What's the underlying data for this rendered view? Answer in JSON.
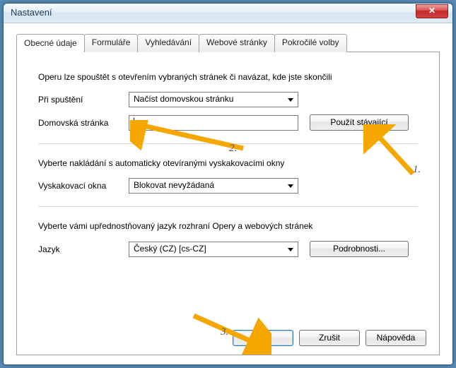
{
  "window": {
    "title": "Nastavení"
  },
  "tabs": {
    "t0": "Obecné údaje",
    "t1": "Formuláře",
    "t2": "Vyhledávání",
    "t3": "Webové stránky",
    "t4": "Pokročilé volby"
  },
  "section1": {
    "text": "Operu lze spouštět s otevřením vybraných stránek či navázat, kde jste skončili",
    "startup_label": "Při spuštění",
    "startup_value": "Načíst domovskou stránku",
    "homepage_label": "Domovská stránka",
    "homepage_value": "",
    "use_current_btn": "Použít stávající"
  },
  "section2": {
    "text": "Vyberte nakládání s automaticky otevíranými vyskakovacími okny",
    "popup_label": "Vyskakovací okna",
    "popup_value": "Blokovat nevyžádaná"
  },
  "section3": {
    "text": "Vyberte vámi upřednostňovaný jazyk rozhraní Opery a webových stránek",
    "lang_label": "Jazyk",
    "lang_value": "Český (CZ) [cs-CZ]",
    "details_btn": "Podrobnosti..."
  },
  "footer": {
    "ok": "OK",
    "cancel": "Zrušit",
    "help": "Nápověda"
  },
  "annotations": {
    "a1": "1.",
    "a2": "2.",
    "a3": "3."
  }
}
